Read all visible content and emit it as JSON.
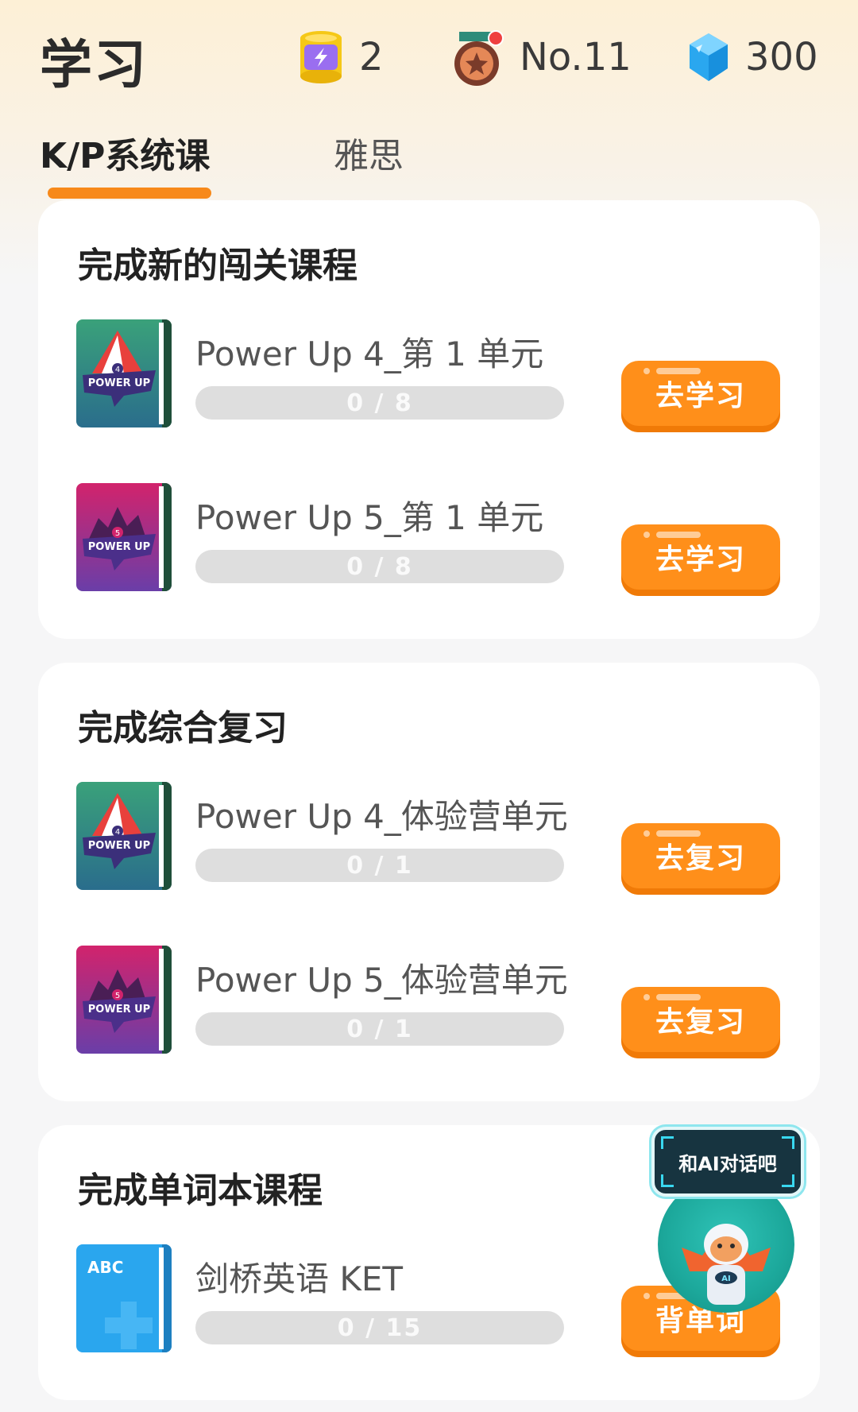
{
  "header": {
    "title": "学习",
    "energy": {
      "value": "2",
      "icon": "energy-can-icon"
    },
    "rank": {
      "value": "No.11",
      "icon": "medal-icon"
    },
    "gems": {
      "value": "300",
      "icon": "gem-icon"
    }
  },
  "tabs": [
    {
      "label": "K/P系统课",
      "active": true
    },
    {
      "label": "雅思",
      "active": false
    }
  ],
  "sections": [
    {
      "title": "完成新的闯关课程",
      "courses": [
        {
          "name": "Power Up 4_第 1 单元",
          "progress": "0 / 8",
          "progress_fraction": 0,
          "button": "去学习",
          "cover_level": "4",
          "cover_label": "POWER UP"
        },
        {
          "name": "Power Up 5_第 1 单元",
          "progress": "0 / 8",
          "progress_fraction": 0,
          "button": "去学习",
          "cover_level": "5",
          "cover_label": "POWER UP"
        }
      ]
    },
    {
      "title": "完成综合复习",
      "courses": [
        {
          "name": "Power Up 4_体验营单元",
          "progress": "0 / 1",
          "progress_fraction": 0,
          "button": "去复习",
          "cover_level": "4",
          "cover_label": "POWER UP"
        },
        {
          "name": "Power Up 5_体验营单元",
          "progress": "0 / 1",
          "progress_fraction": 0,
          "button": "去复习",
          "cover_level": "5",
          "cover_label": "POWER UP"
        }
      ]
    },
    {
      "title": "完成单词本课程",
      "courses": [
        {
          "name": "剑桥英语 KET",
          "progress": "0 / 15",
          "progress_fraction": 0,
          "button": "背单词",
          "cover_label": "ABC"
        }
      ]
    }
  ],
  "ai_chat": {
    "label": "和AI对话吧",
    "badge": "AI"
  },
  "colors": {
    "accent": "#f7891a",
    "button": "#ff8f1a",
    "progress_track": "#dedede"
  }
}
